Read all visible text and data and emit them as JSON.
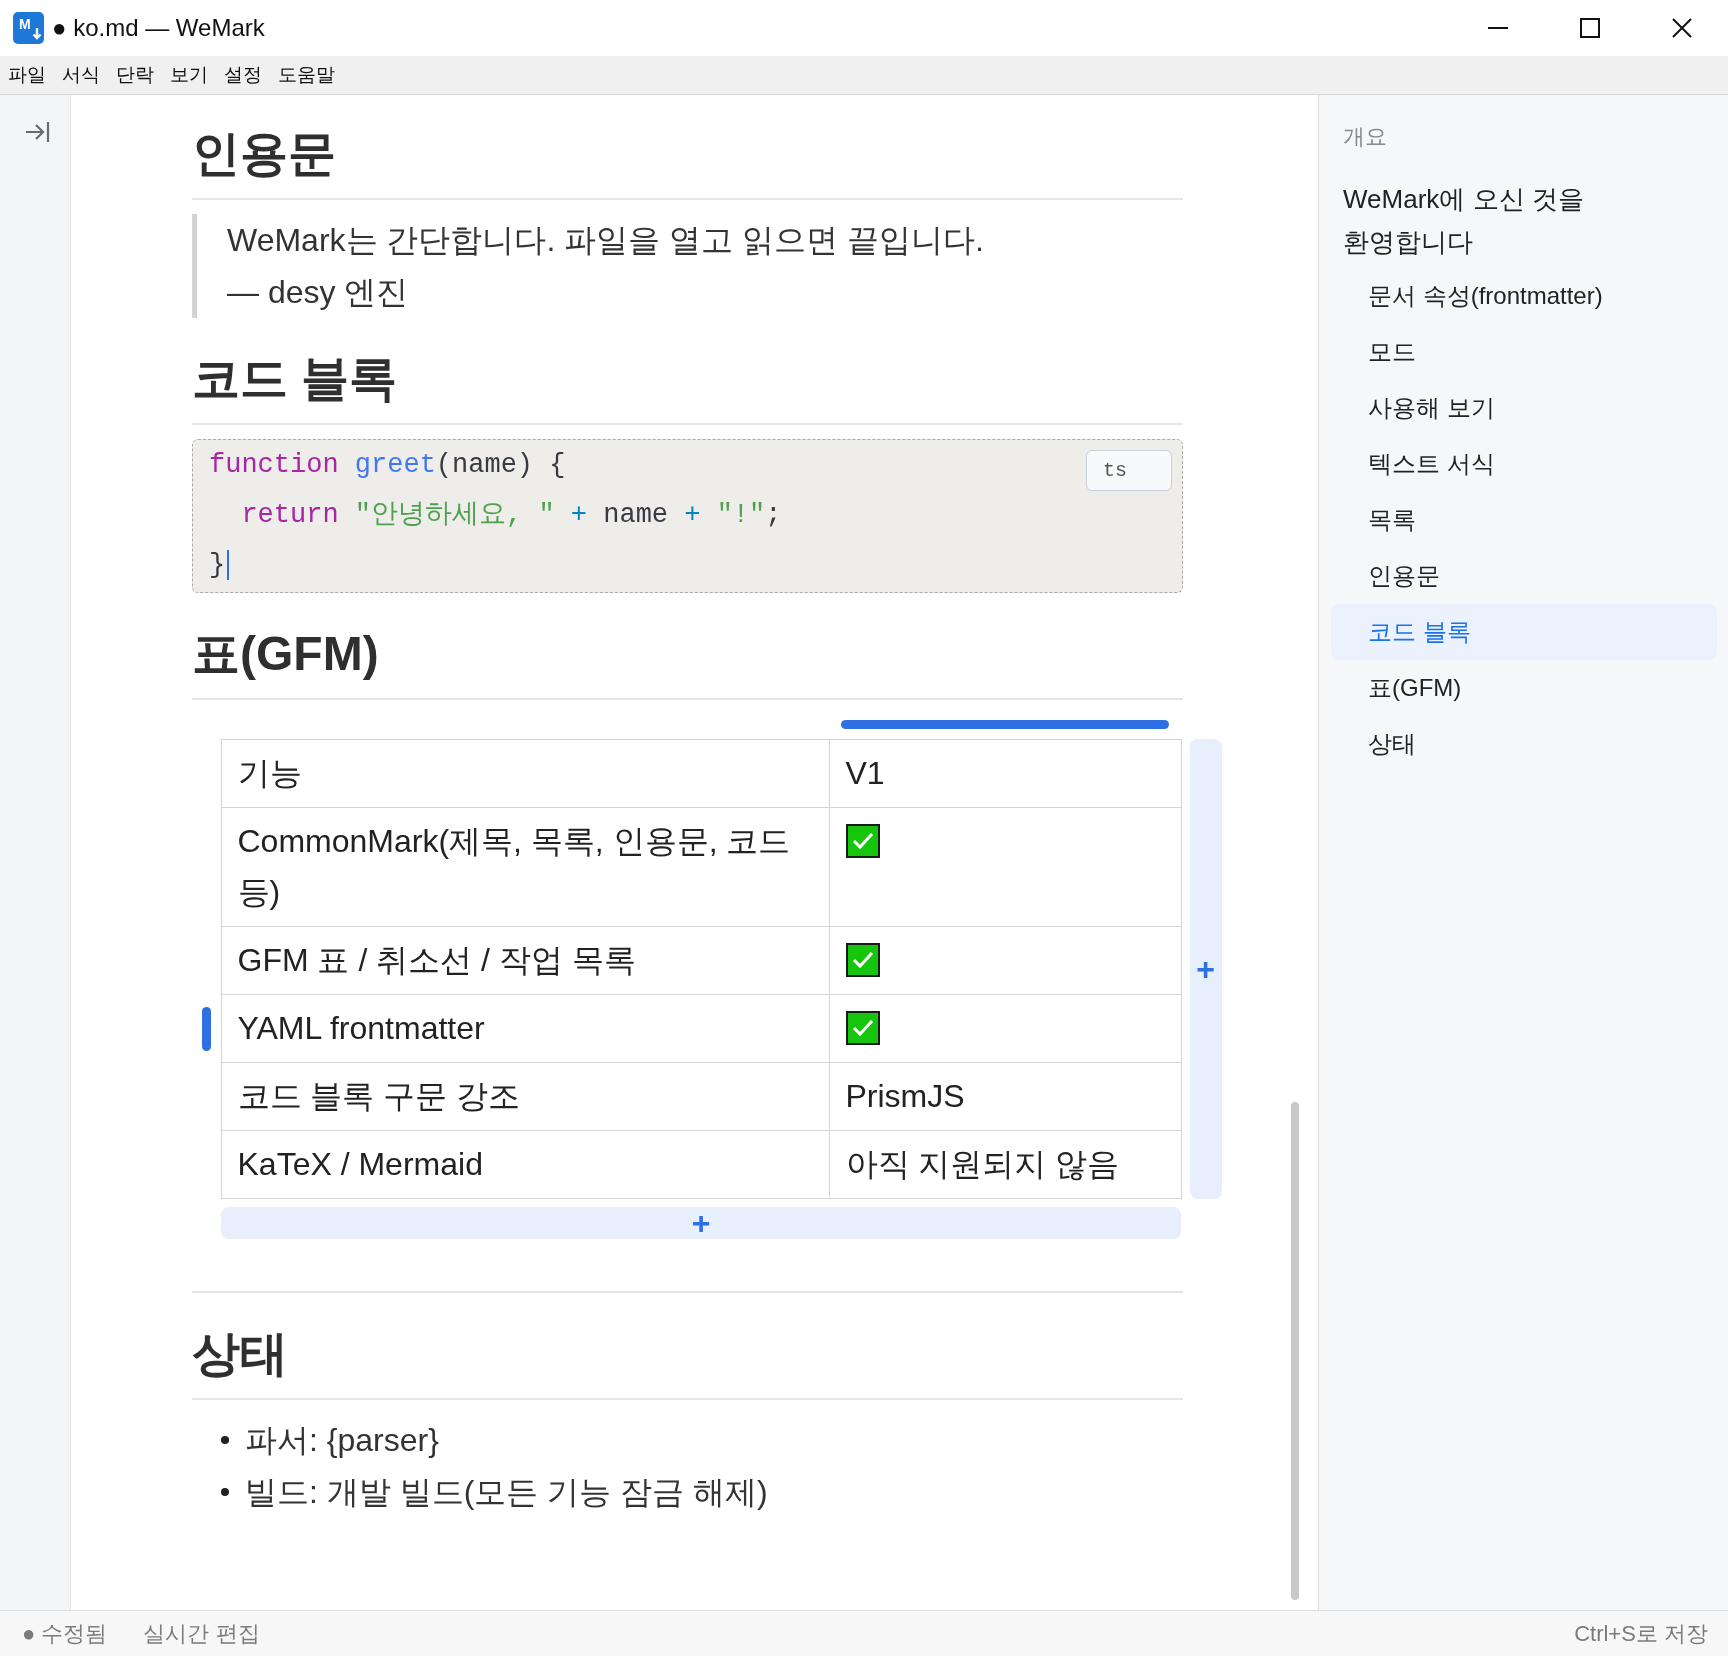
{
  "window": {
    "title": "● ko.md — WeMark",
    "logo_text": "M"
  },
  "menu": [
    "파일",
    "서식",
    "단락",
    "보기",
    "설정",
    "도움말"
  ],
  "document": {
    "blocks": [
      {
        "kind": "heading",
        "text": "인용문"
      },
      {
        "kind": "blockquote",
        "lines": [
          "WeMark는 간단합니다. 파일을 열고 읽으면 끝입니다.",
          "— desy 엔진"
        ]
      },
      {
        "kind": "heading",
        "text": "코드 블록"
      },
      {
        "kind": "code",
        "language": "ts",
        "lines": [
          {
            "caret": false,
            "tokens": [
              {
                "kind": "keyword",
                "text": "function"
              },
              {
                "kind": "function",
                "text": " greet"
              },
              {
                "kind": "plain",
                "text": "(name) {"
              }
            ]
          },
          {
            "caret": false,
            "tokens": [
              {
                "kind": "keyword",
                "text": "  return"
              },
              {
                "kind": "string",
                "text": " \"안녕하세요, \""
              },
              {
                "kind": "operator",
                "text": " + "
              },
              {
                "kind": "plain",
                "text": "name"
              },
              {
                "kind": "operator",
                "text": " + "
              },
              {
                "kind": "string",
                "text": "\"!\""
              },
              {
                "kind": "plain",
                "text": ";"
              }
            ]
          },
          {
            "caret": true,
            "tokens": [
              {
                "kind": "plain",
                "text": "}"
              }
            ]
          }
        ]
      },
      {
        "kind": "heading",
        "text": "표(GFM)"
      },
      {
        "kind": "table",
        "columns": [
          {
            "label": "기능",
            "selected": false
          },
          {
            "label": "V1",
            "selected": true
          }
        ],
        "rows": [
          {
            "selected": false,
            "cells": [
              {
                "kind": "text",
                "text": "CommonMark(제목, 목록, 인용문, 코드 등)"
              },
              {
                "kind": "check",
                "checked": true
              }
            ]
          },
          {
            "selected": false,
            "cells": [
              {
                "kind": "text",
                "text": "GFM 표 / 취소선 / 작업 목록"
              },
              {
                "kind": "check",
                "checked": true
              }
            ]
          },
          {
            "selected": true,
            "cells": [
              {
                "kind": "text",
                "text": "YAML frontmatter"
              },
              {
                "kind": "check",
                "checked": true
              }
            ]
          },
          {
            "selected": false,
            "cells": [
              {
                "kind": "text",
                "text": "코드 블록 구문 강조"
              },
              {
                "kind": "text",
                "text": "PrismJS"
              }
            ]
          },
          {
            "selected": false,
            "cells": [
              {
                "kind": "text",
                "text": "KaTeX / Mermaid"
              },
              {
                "kind": "text",
                "text": "아직 지원되지 않음"
              }
            ]
          }
        ],
        "add_column": "+",
        "add_row": "+"
      },
      {
        "kind": "rule"
      },
      {
        "kind": "heading",
        "text": "상태"
      },
      {
        "kind": "list",
        "items": [
          "파서: {parser}",
          "빌드: 개발 빌드(모든 기능 잠금 해제)"
        ]
      }
    ]
  },
  "outline": {
    "title": "개요",
    "items": [
      {
        "label": "WeMark에 오신 것을 환영합니다",
        "selected": false,
        "children": [
          {
            "label": "문서 속성(frontmatter)",
            "selected": false
          },
          {
            "label": "모드",
            "selected": false
          },
          {
            "label": "사용해 보기",
            "selected": false
          },
          {
            "label": "텍스트 서식",
            "selected": false
          },
          {
            "label": "목록",
            "selected": false
          },
          {
            "label": "인용문",
            "selected": false
          },
          {
            "label": "코드 블록",
            "selected": true
          },
          {
            "label": "표(GFM)",
            "selected": false
          },
          {
            "label": "상태",
            "selected": false
          }
        ]
      }
    ]
  },
  "status_bar": {
    "left": [
      "● 수정됨",
      "실시간 편집"
    ],
    "right": "Ctrl+S로 저장"
  }
}
